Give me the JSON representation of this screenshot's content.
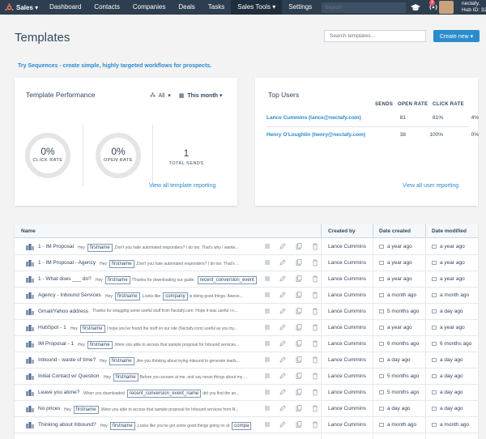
{
  "nav": {
    "brand": "Sales",
    "items": [
      "Dashboard",
      "Contacts",
      "Companies",
      "Deals",
      "Tasks",
      "Sales Tools",
      "Settings"
    ],
    "active": "Sales Tools",
    "search_placeholder": "Search",
    "notification_count": "3",
    "account_name": "nectafy.",
    "hub_id": "Hub ID: 32",
    "colors": {
      "bg": "#2d3e50",
      "active": "#1f2e3d",
      "badge": "#f2545b"
    }
  },
  "header": {
    "title": "Templates",
    "search_placeholder": "Search templates...",
    "create_label": "Create new"
  },
  "promo": "Try Sequences - create simple, highly targeted workflows for prospects.",
  "performance": {
    "title": "Template Performance",
    "filter_scope": "All",
    "filter_period": "This month",
    "click_rate": {
      "value": "0%",
      "label": "CLICK RATE"
    },
    "open_rate": {
      "value": "0%",
      "label": "OPEN RATE"
    },
    "total_sends": {
      "value": "1",
      "label": "TOTAL SENDS"
    },
    "link": "View all template reporting"
  },
  "top_users": {
    "title": "Top Users",
    "columns": [
      "SENDS",
      "OPEN RATE",
      "CLICK RATE"
    ],
    "rows": [
      {
        "name": "Lance Cummins (lance@nectafy.com)",
        "sends": "81",
        "open_rate": "81%",
        "click_rate": "4%"
      },
      {
        "name": "Henry O'Loughlin (henry@nectafy.com)",
        "sends": "38",
        "open_rate": "100%",
        "click_rate": "0%"
      }
    ],
    "link": "View all user reporting"
  },
  "table": {
    "columns": {
      "name": "Name",
      "created_by": "Created by",
      "date_created": "Date created",
      "date_modified": "Date modified"
    },
    "rows": [
      {
        "name": "1 - IM Proposal",
        "preview": [
          {
            "t": "Hey"
          },
          {
            "tag": "firstname"
          },
          {
            "t": ",Don't you hate automated responders? I do too. That's why I wante..."
          }
        ],
        "created_by": "Lance Cummins",
        "date_created": "a year ago",
        "date_modified": "a year ago"
      },
      {
        "name": "1 - IM Proposal - Agency",
        "preview": [
          {
            "t": "Hey"
          },
          {
            "tag": "firstname"
          },
          {
            "t": ",Don't you hate automated responders? I do too. That's ..."
          }
        ],
        "created_by": "Lance Cummins",
        "date_created": "a year ago",
        "date_modified": "a year ago"
      },
      {
        "name": "1 - What does ___ do?",
        "preview": [
          {
            "t": "Hey"
          },
          {
            "tag": "firstname"
          },
          {
            "t": "!Thanks for downloading our guide."
          },
          {
            "tag": "recent_conversion_event"
          }
        ],
        "created_by": "Lance Cummins",
        "date_created": "a year ago",
        "date_modified": "a year ago"
      },
      {
        "name": "Agency - Inbound Services",
        "preview": [
          {
            "t": "Hey"
          },
          {
            "tag": "firstname"
          },
          {
            "t": ",Looks like"
          },
          {
            "tag": "company"
          },
          {
            "t": "is doing good things. Aweso..."
          }
        ],
        "created_by": "Lance Cummins",
        "date_created": "a month ago",
        "date_modified": "a month ago"
      },
      {
        "name": "Gmail/Yahoo address",
        "preview": [
          {
            "t": "Thanks for snagging some useful stuff from Nectafy.com. Hope it was useful l n..."
          }
        ],
        "created_by": "Lance Cummins",
        "date_created": "5 months ago",
        "date_modified": "a day ago"
      },
      {
        "name": "HubSpot - 1",
        "preview": [
          {
            "t": "Hey"
          },
          {
            "tag": "firstname"
          },
          {
            "t": "I hope you've found the stuff on our site (Nectafy.com) useful as you try..."
          }
        ],
        "created_by": "Lance Cummins",
        "date_created": "a year ago",
        "date_modified": "a year ago"
      },
      {
        "name": "IM Proposal - 1",
        "preview": [
          {
            "t": "Hey"
          },
          {
            "tag": "firstname"
          },
          {
            "t": ",Were you able to access that sample proposal for Inbound services..."
          }
        ],
        "created_by": "Lance Cummins",
        "date_created": "6 months ago",
        "date_modified": "6 months ago"
      },
      {
        "name": "Inbound - waste of time?",
        "preview": [
          {
            "t": "Hey"
          },
          {
            "tag": "firstname"
          },
          {
            "t": ",Are you thinking about trying inbound to generate leads..."
          }
        ],
        "created_by": "Lance Cummins",
        "date_created": "a day ago",
        "date_modified": "a day ago"
      },
      {
        "name": "Initial Contact w/ Question",
        "preview": [
          {
            "t": "Hey"
          },
          {
            "tag": "firstname"
          },
          {
            "t": "Before you scream at me, and say mean things about my ..."
          }
        ],
        "created_by": "Lance Cummins",
        "date_created": "5 months ago",
        "date_modified": "a day ago"
      },
      {
        "name": "Leave you alone?",
        "preview": [
          {
            "t": "When you downloaded"
          },
          {
            "tag": "recent_conversion_event_name"
          },
          {
            "t": "did you find the an..."
          }
        ],
        "created_by": "Lance Cummins",
        "date_created": "5 months ago",
        "date_modified": "a day ago"
      },
      {
        "name": "No prices",
        "preview": [
          {
            "t": "Hey"
          },
          {
            "tag": "firstname"
          },
          {
            "t": ",Were you able to access that sample proposal for Inbound services from N..."
          }
        ],
        "created_by": "Lance Cummins",
        "date_created": "a day ago",
        "date_modified": "a day ago"
      },
      {
        "name": "Thinking about Inbound?",
        "preview": [
          {
            "t": "Hey"
          },
          {
            "tag": "firstname"
          },
          {
            "t": ",Looks like you've got some good things going on at"
          },
          {
            "tag": "compa"
          }
        ],
        "created_by": "Lance Cummins",
        "date_created": "a month ago",
        "date_modified": "a month ago"
      }
    ],
    "row_icons": [
      "template-icon",
      "list-icon",
      "edit-icon",
      "copy-icon",
      "delete-icon",
      "calendar-icon"
    ]
  }
}
